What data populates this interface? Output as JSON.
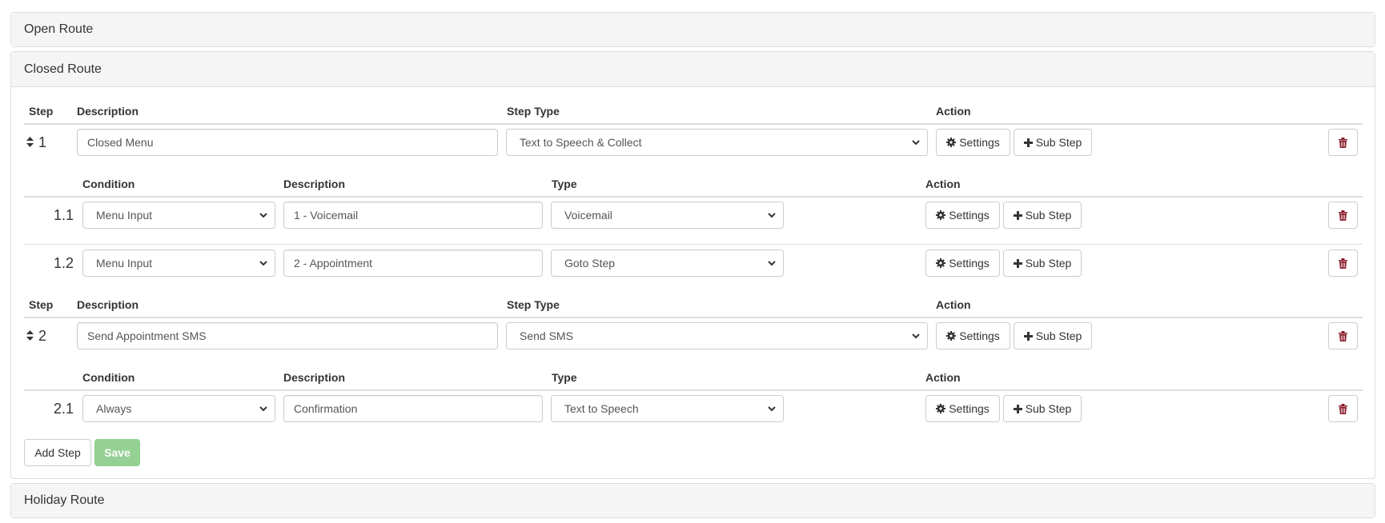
{
  "panels": {
    "open_route": "Open Route",
    "closed_route": "Closed Route",
    "holiday_route": "Holiday Route"
  },
  "step_headers": {
    "step": "Step",
    "description": "Description",
    "step_type": "Step Type",
    "action": "Action"
  },
  "substep_headers": {
    "condition": "Condition",
    "description": "Description",
    "type": "Type",
    "action": "Action"
  },
  "buttons": {
    "settings": "Settings",
    "sub_step": "Sub Step",
    "add_step": "Add Step",
    "save": "Save"
  },
  "steps": [
    {
      "number": "1",
      "description": "Closed Menu",
      "step_type": "Text to Speech & Collect",
      "substeps": [
        {
          "number": "1.1",
          "condition": "Menu Input",
          "description": "1 - Voicemail",
          "type": "Voicemail"
        },
        {
          "number": "1.2",
          "condition": "Menu Input",
          "description": "2 - Appointment",
          "type": "Goto Step"
        }
      ]
    },
    {
      "number": "2",
      "description": "Send Appointment SMS",
      "step_type": "Send SMS",
      "substeps": [
        {
          "number": "2.1",
          "condition": "Always",
          "description": "Confirmation",
          "type": "Text to Speech"
        }
      ]
    }
  ],
  "icons": {
    "sort": "sort-icon",
    "gear": "gear-icon",
    "plus": "plus-icon",
    "trash": "trash-icon",
    "chevron": "chevron-down-icon"
  },
  "colors": {
    "save_button": "#95d095",
    "trash_icon": "#8b1c2c",
    "panel_heading": "#f5f5f5"
  }
}
